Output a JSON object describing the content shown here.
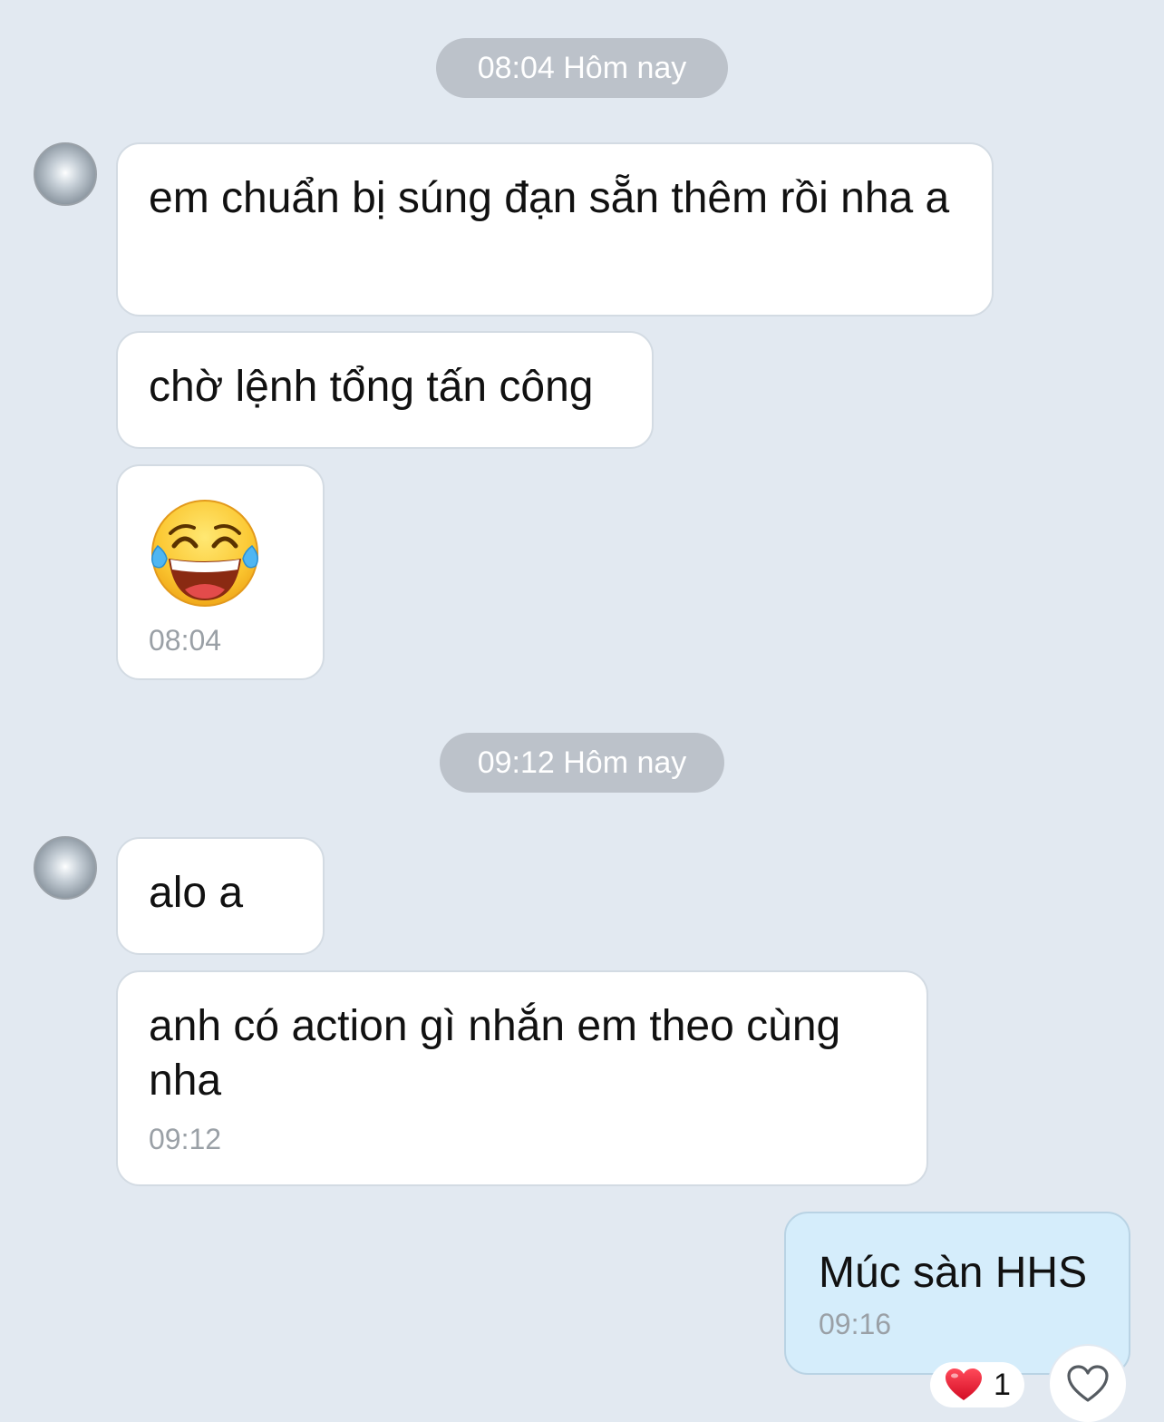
{
  "separators": [
    {
      "label": "08:04 Hôm nay"
    },
    {
      "label": "09:12 Hôm nay"
    }
  ],
  "messages": [
    {
      "text": "em chuẩn bị súng đạn sẵn thêm rồi nha a"
    },
    {
      "text": "chờ lệnh tổng tấn công"
    },
    {
      "emoji": "face-with-tears-of-joy",
      "time": "08:04"
    },
    {
      "text": "alo a"
    },
    {
      "text": "anh có action gì nhắn em theo cùng nha",
      "time": "09:12"
    },
    {
      "text": "Múc sàn HHS",
      "time": "09:16"
    }
  ],
  "reaction": {
    "icon": "red-heart-icon",
    "count": "1"
  },
  "like_button": {
    "icon": "heart-outline-icon"
  },
  "colors": {
    "background": "#e2e9f1",
    "received_bubble": "#ffffff",
    "sent_bubble": "#d5edfb",
    "time_pill": "#bcc2ca",
    "heart": "#e0172e"
  }
}
